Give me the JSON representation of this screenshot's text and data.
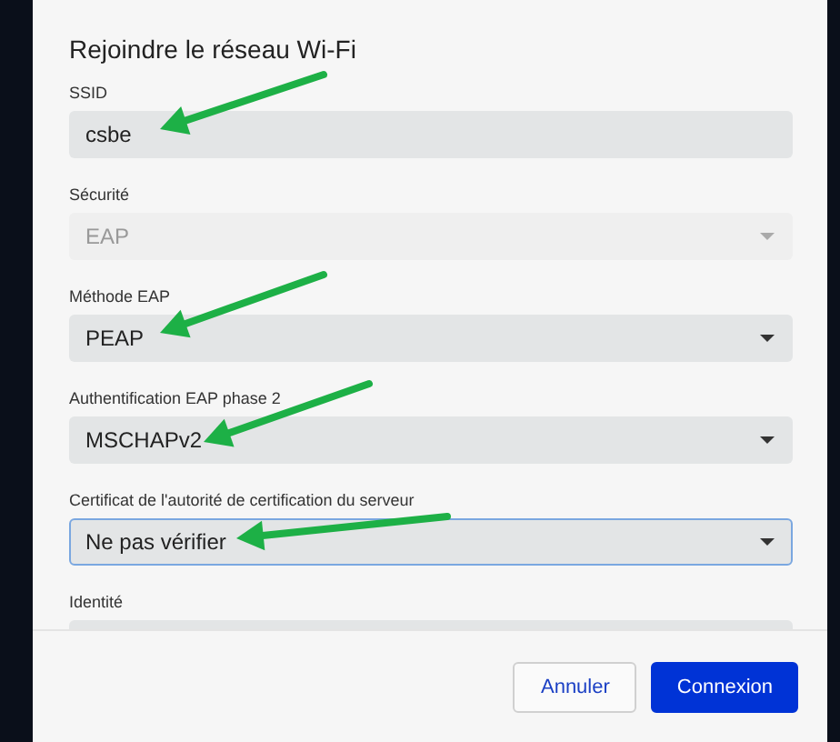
{
  "dialog": {
    "title": "Rejoindre le réseau Wi-Fi",
    "fields": [
      {
        "kind": "text",
        "label": "SSID",
        "value": "csbe",
        "disabled": false,
        "focused": false,
        "pointed": true
      },
      {
        "kind": "select",
        "label": "Sécurité",
        "value": "EAP",
        "disabled": true,
        "focused": false,
        "pointed": false
      },
      {
        "kind": "select",
        "label": "Méthode EAP",
        "value": "PEAP",
        "disabled": false,
        "focused": false,
        "pointed": true
      },
      {
        "kind": "select",
        "label": "Authentification EAP phase 2",
        "value": "MSCHAPv2",
        "disabled": false,
        "focused": false,
        "pointed": true
      },
      {
        "kind": "select",
        "label": "Certificat de l'autorité de certification du serveur",
        "value": "Ne pas vérifier",
        "disabled": false,
        "focused": true,
        "pointed": true
      },
      {
        "kind": "text",
        "label": "Identité",
        "disabled": false,
        "focused": false,
        "pointed": false
      }
    ],
    "buttons": [
      {
        "label": "Annuler",
        "primary": false
      },
      {
        "label": "Connexion",
        "primary": true
      }
    ]
  }
}
